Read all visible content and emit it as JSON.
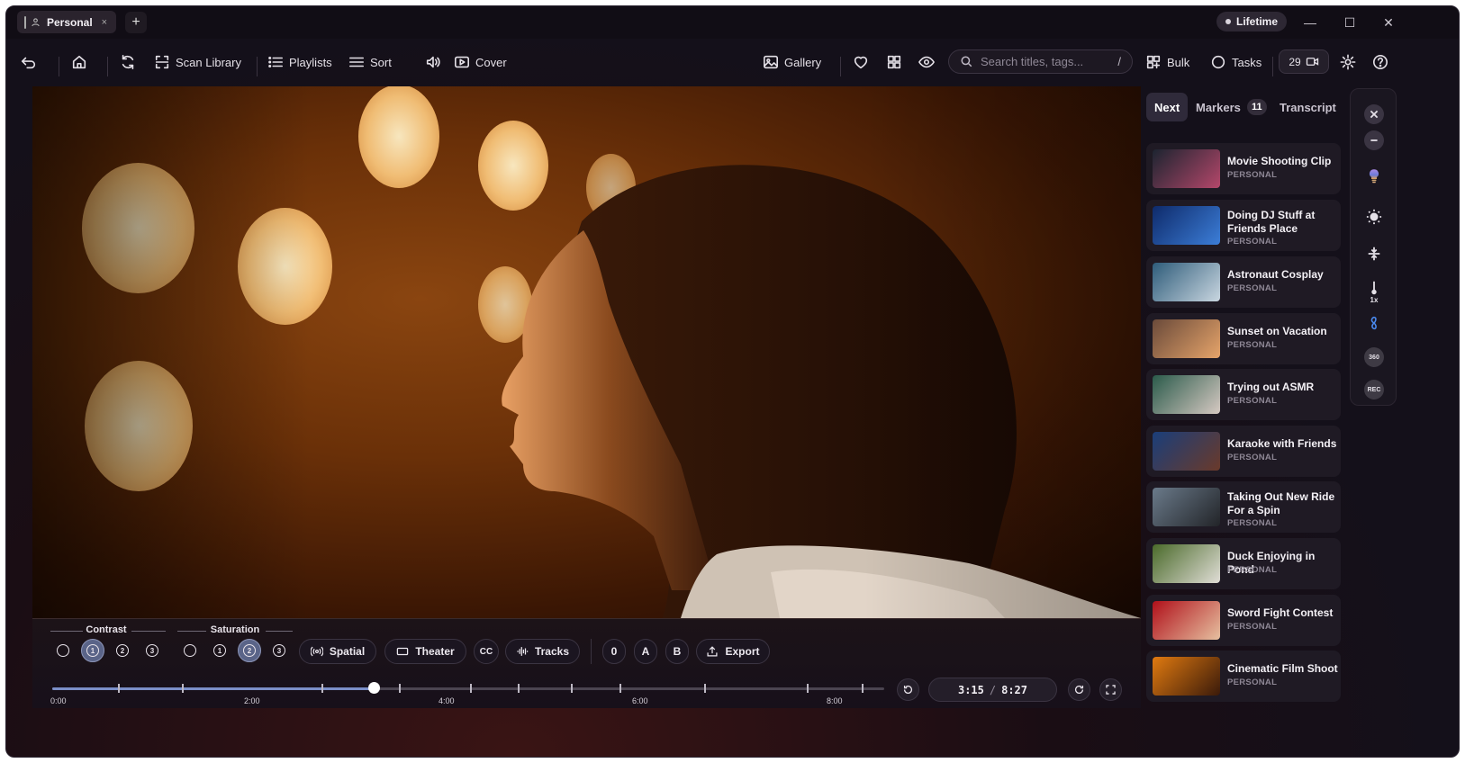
{
  "window": {
    "tab_label": "Personal",
    "tab_close": "×",
    "new_tab": "+",
    "plan_badge": "Lifetime",
    "minimize": "—",
    "maximize": "☐",
    "close": "✕"
  },
  "toolbar": {
    "scan_library": "Scan Library",
    "playlists": "Playlists",
    "sort": "Sort",
    "cover": "Cover",
    "gallery": "Gallery",
    "search_placeholder": "Search titles, tags...",
    "search_shortcut": "/",
    "bulk": "Bulk",
    "tasks": "Tasks",
    "recordings_count": "29"
  },
  "player": {
    "contrast_label": "Contrast",
    "saturation_label": "Saturation",
    "contrast_options": [
      "",
      "1",
      "2",
      "3"
    ],
    "contrast_selected": "1",
    "saturation_options": [
      "",
      "1",
      "2",
      "3"
    ],
    "saturation_selected": "2",
    "spatial": "Spatial",
    "theater": "Theater",
    "cc": "CC",
    "tracks": "Tracks",
    "loop_zero": "0",
    "loop_a": "A",
    "loop_b": "B",
    "export": "Export",
    "current_time": "3:15",
    "time_sep": "/",
    "duration": "8:27",
    "progress_fraction": 0.386,
    "timeline_labels": [
      "0:00",
      "2:00",
      "4:00",
      "6:00",
      "8:00"
    ]
  },
  "sidebar": {
    "tabs": [
      {
        "label": "Next"
      },
      {
        "label": "Markers",
        "badge": "11"
      },
      {
        "label": "Transcript"
      }
    ],
    "items": [
      {
        "title": "Movie Shooting Clip",
        "sub": "PERSONAL",
        "thumb": [
          "#1c2430",
          "#b4476a"
        ]
      },
      {
        "title": "Doing DJ Stuff at Friends Place",
        "sub": "PERSONAL",
        "thumb": [
          "#0e2a6a",
          "#3c7ed8"
        ]
      },
      {
        "title": "Astronaut Cosplay",
        "sub": "PERSONAL",
        "thumb": [
          "#2e5c7a",
          "#c9d6e0"
        ]
      },
      {
        "title": "Sunset on Vacation",
        "sub": "PERSONAL",
        "thumb": [
          "#6a4a3a",
          "#e6a46a"
        ]
      },
      {
        "title": "Trying out ASMR",
        "sub": "PERSONAL",
        "thumb": [
          "#2a5a4a",
          "#d6c9c2"
        ]
      },
      {
        "title": "Karaoke with Friends",
        "sub": "PERSONAL",
        "thumb": [
          "#1a3e7a",
          "#6a3a2a"
        ]
      },
      {
        "title": "Taking Out New Ride For a Spin",
        "sub": "PERSONAL",
        "thumb": [
          "#6a7a8a",
          "#222428"
        ]
      },
      {
        "title": "Duck Enjoying in Pond",
        "sub": "PERSONAL",
        "thumb": [
          "#4a6a2a",
          "#e0ddd6"
        ]
      },
      {
        "title": "Sword Fight Contest",
        "sub": "PERSONAL",
        "thumb": [
          "#b0101a",
          "#e6c0a0"
        ]
      },
      {
        "title": "Cinematic Film Shoot",
        "sub": "PERSONAL",
        "thumb": [
          "#e07a10",
          "#3a1a0a"
        ]
      }
    ]
  },
  "rail": {
    "speed_label": "1x",
    "badge_360": "360",
    "badge_rec": "REC"
  },
  "colors": {
    "accent": "#7b8fc8",
    "selected_ring": "#5a6488",
    "background": "#14101a"
  }
}
